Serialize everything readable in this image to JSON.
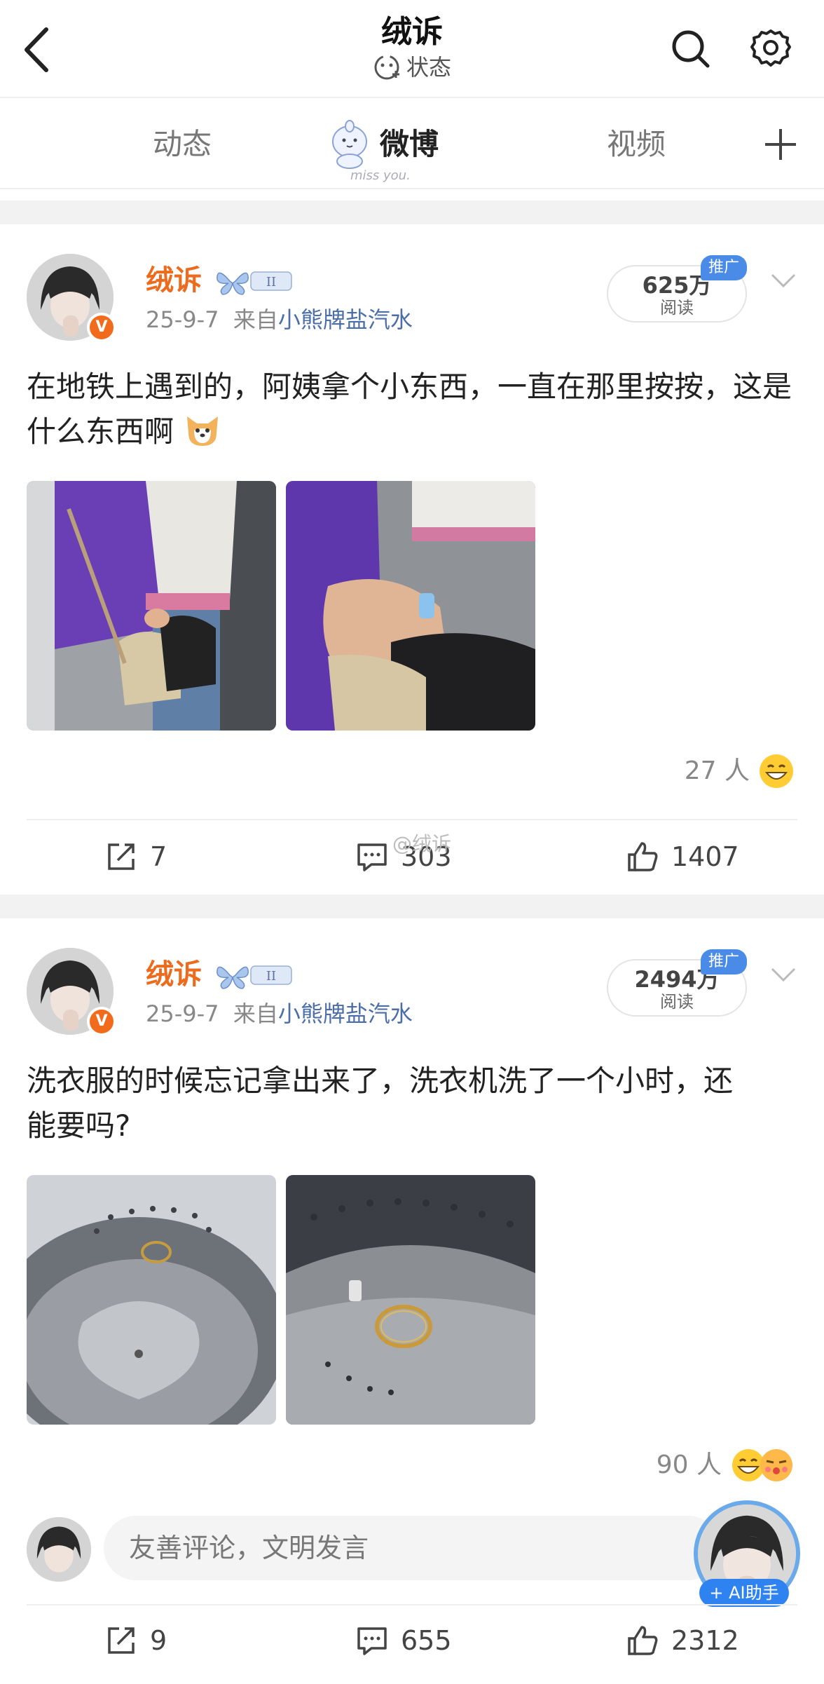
{
  "header": {
    "title": "绒诉",
    "status_label": "状态"
  },
  "tabs": [
    {
      "label": "动态",
      "active": false
    },
    {
      "label": "微博",
      "active": true
    },
    {
      "label": "视频",
      "active": false
    }
  ],
  "mascot_caption": "miss you.",
  "posts": [
    {
      "username": "绒诉",
      "badge_text": "II",
      "date": "25-9-7",
      "from_prefix": "来自",
      "source": "小熊牌盐汽水",
      "reads": "625万",
      "reads_label": "阅读",
      "promo_label": "推广",
      "text": "在地铁上遇到的，阿姨拿个小东西，一直在那里按按，这是什么东西啊",
      "reaction_count": "27 人",
      "reposts": "7",
      "comments": "303",
      "likes": "1407"
    },
    {
      "username": "绒诉",
      "badge_text": "II",
      "date": "25-9-7",
      "from_prefix": "来自",
      "source": "小熊牌盐汽水",
      "reads": "2494万",
      "reads_label": "阅读",
      "promo_label": "推广",
      "text": "洗衣服的时候忘记拿出来了，洗衣机洗了一个小时，还能要吗?",
      "reaction_count": "90 人",
      "reposts": "9",
      "comments": "655",
      "likes": "2312"
    }
  ],
  "watermark": "@绒诉",
  "comment_bar": {
    "placeholder": "友善评论，文明发言",
    "ai_label": "+ AI助手"
  },
  "colors": {
    "username": "#ec6b1d",
    "source_link": "#4b6ea8",
    "promo": "#4a8be8",
    "ai_badge": "#2f83f0"
  }
}
